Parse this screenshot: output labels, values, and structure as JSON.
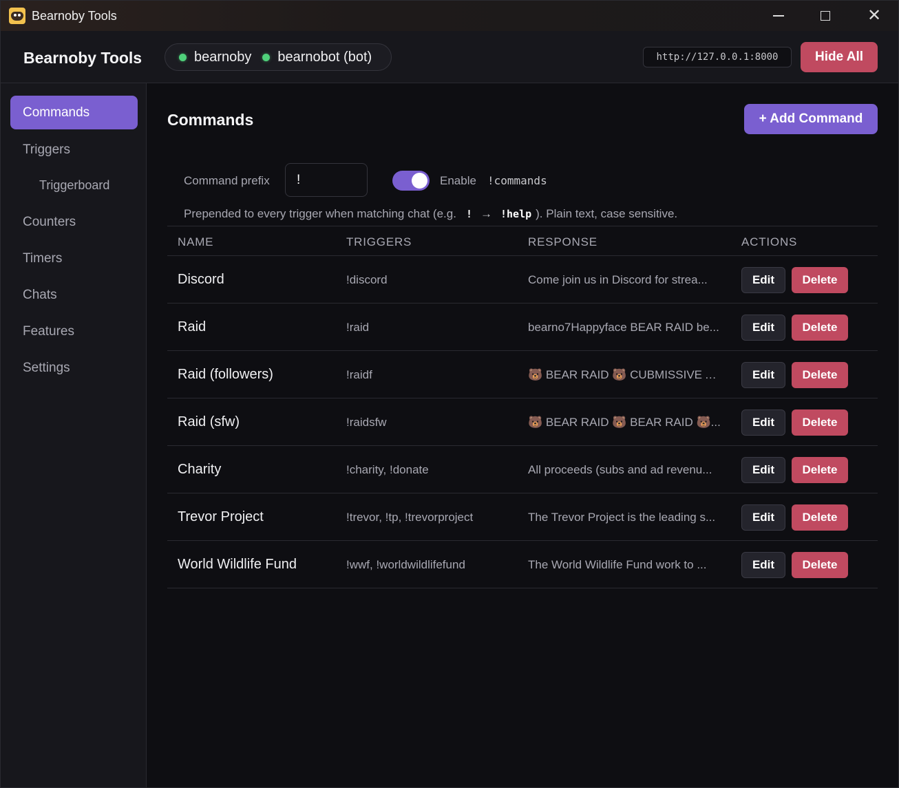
{
  "window": {
    "title": "Bearnoby Tools"
  },
  "header": {
    "brand": "Bearnoby Tools",
    "accounts": [
      {
        "name": "bearnoby"
      },
      {
        "name": "bearnobot (bot)"
      }
    ],
    "server_url": "http://127.0.0.1:8000",
    "hide_all_label": "Hide All"
  },
  "sidebar": {
    "items": [
      {
        "label": "Commands"
      },
      {
        "label": "Triggers"
      },
      {
        "label": "Triggerboard"
      },
      {
        "label": "Counters"
      },
      {
        "label": "Timers"
      },
      {
        "label": "Chats"
      },
      {
        "label": "Features"
      },
      {
        "label": "Settings"
      }
    ]
  },
  "main": {
    "title": "Commands",
    "add_button_label": "+ Add Command",
    "prefix_label": "Command prefix",
    "prefix_value": "!",
    "enable_label": "Enable",
    "enable_code": "!commands",
    "hint_before": "Prepended to every trigger when matching chat (e.g.",
    "hint_code_prefix": "!",
    "hint_arrow": "→",
    "hint_code_example": "!help",
    "hint_after": "). Plain text, case sensitive.",
    "columns": {
      "name": "NAME",
      "triggers": "TRIGGERS",
      "response": "RESPONSE",
      "actions": "ACTIONS"
    },
    "edit_label": "Edit",
    "delete_label": "Delete",
    "rows": [
      {
        "name": "Discord",
        "triggers": "!discord",
        "response": "Come join us in Discord for strea..."
      },
      {
        "name": "Raid",
        "triggers": "!raid",
        "response": "bearno7Happyface BEAR RAID be..."
      },
      {
        "name": "Raid (followers)",
        "triggers": "!raidf",
        "response": "🐻 BEAR RAID 🐻 CUBMISSIVE A..."
      },
      {
        "name": "Raid (sfw)",
        "triggers": "!raidsfw",
        "response": "🐻 BEAR RAID 🐻 BEAR RAID 🐻..."
      },
      {
        "name": "Charity",
        "triggers": "!charity, !donate",
        "response": "All proceeds (subs and ad revenu..."
      },
      {
        "name": "Trevor Project",
        "triggers": "!trevor, !tp, !trevorproject",
        "response": "The Trevor Project is the leading s..."
      },
      {
        "name": "World Wildlife Fund",
        "triggers": "!wwf, !worldwildlifefund",
        "response": "The World Wildlife Fund work to ..."
      }
    ]
  },
  "colors": {
    "accent": "#7a5fd0",
    "danger": "#c04a60",
    "online": "#4fd07a"
  }
}
